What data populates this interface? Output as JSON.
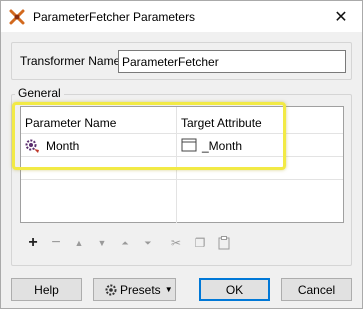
{
  "window": {
    "title": "ParameterFetcher Parameters",
    "close_glyph": "✕"
  },
  "transformer": {
    "label": "Transformer Name:",
    "value": "ParameterFetcher"
  },
  "general": {
    "label": "General"
  },
  "table": {
    "headers": [
      "Parameter Name",
      "Target Attribute"
    ],
    "rows": [
      {
        "parameter": "Month",
        "target": "_Month"
      }
    ]
  },
  "toolbar": {
    "icons": [
      "add-icon",
      "remove-icon",
      "move-up-icon",
      "move-down-icon",
      "move-top-icon",
      "move-bottom-icon",
      "cut-icon",
      "copy-icon",
      "paste-icon"
    ]
  },
  "buttons": {
    "help": "Help",
    "presets": "Presets",
    "ok": "OK",
    "cancel": "Cancel"
  },
  "colors": {
    "highlight": "#f2ea45",
    "default_button_border": "#0078d7"
  }
}
